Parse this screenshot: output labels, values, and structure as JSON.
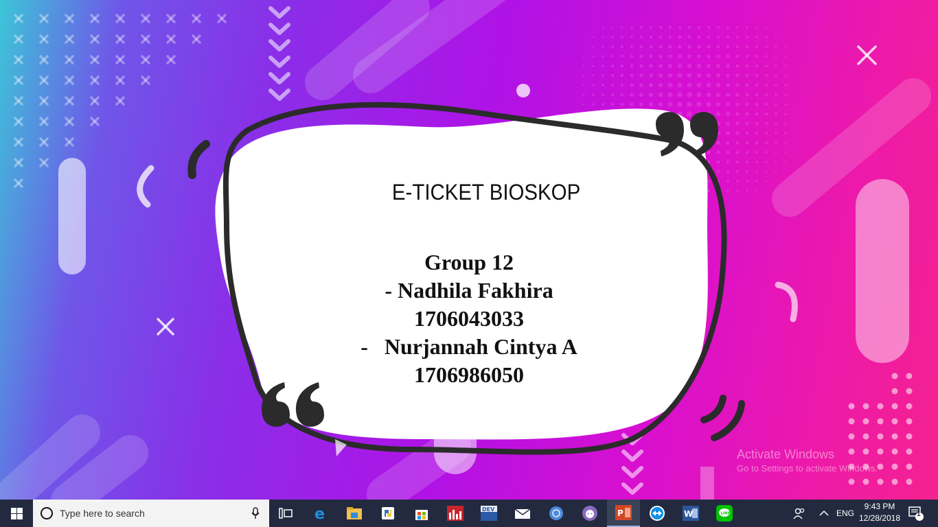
{
  "slide": {
    "title": "E-TICKET BIOSKOP",
    "lines": [
      "Group 12",
      "- Nadhila Fakhira",
      "1706043033",
      "-   Nurjannah Cintya A",
      "1706986050"
    ]
  },
  "watermark": {
    "line1": "Activate Windows",
    "line2": "Go to Settings to activate Windows."
  },
  "taskbar": {
    "search_placeholder": "Type here to search",
    "apps": [
      "task-view",
      "edge",
      "file-explorer",
      "python",
      "store",
      "spss",
      "dev-cpp",
      "mail",
      "chrome",
      "github",
      "powerpoint",
      "teamviewer",
      "word",
      "line"
    ],
    "active_app": "powerpoint",
    "language": "ENG",
    "time": "9:43 PM",
    "date": "12/28/2018",
    "notification_count": "1"
  }
}
